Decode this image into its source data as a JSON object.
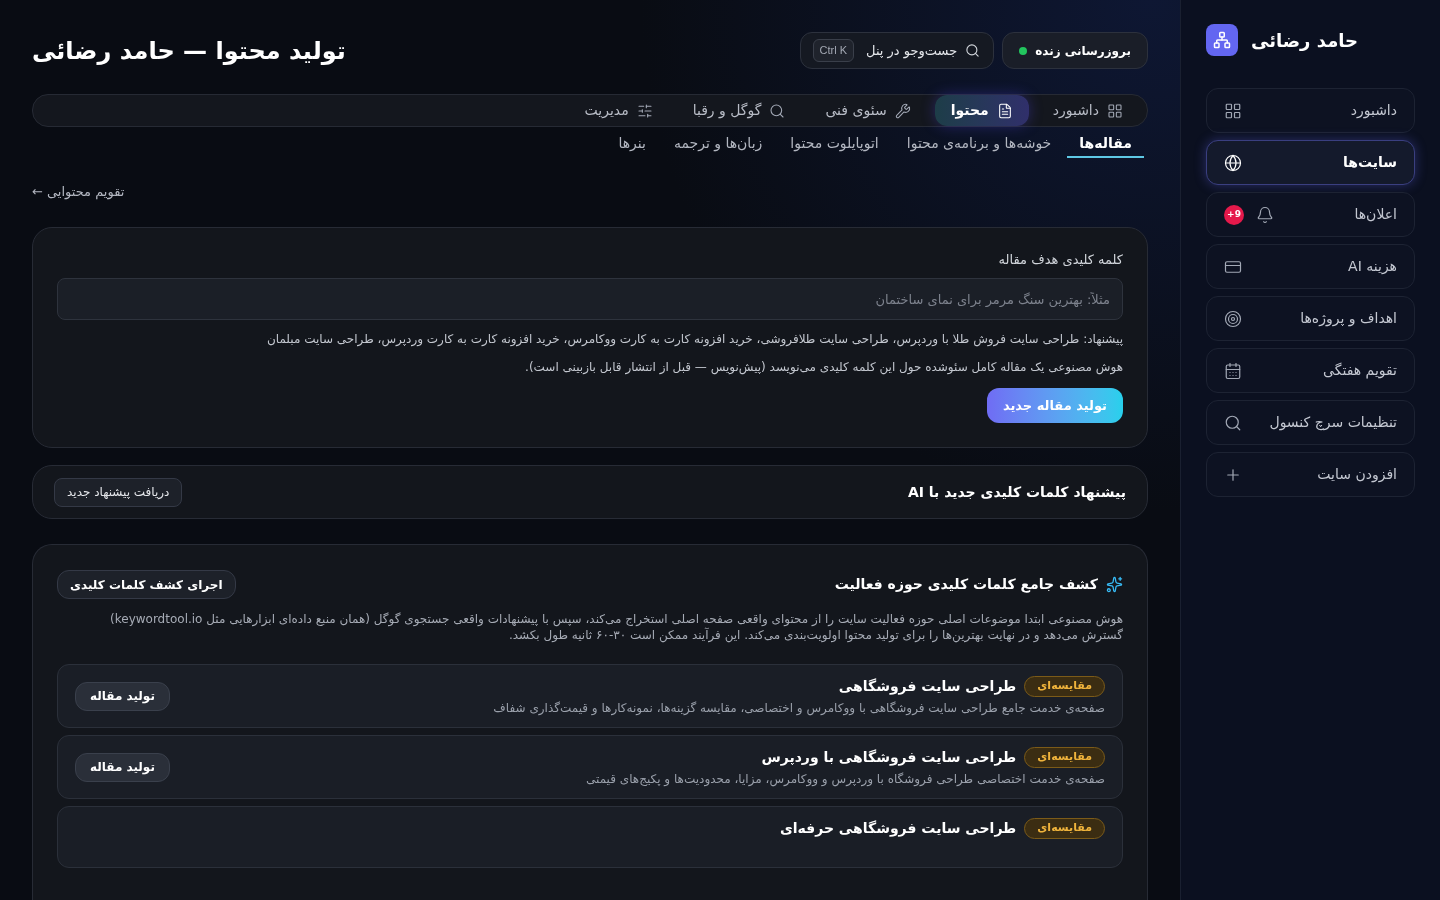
{
  "sidebar": {
    "brand": "حامد رضائی",
    "items": [
      {
        "label": "داشبورد",
        "selected": false
      },
      {
        "label": "سایت‌ها",
        "selected": true
      },
      {
        "label": "اعلان‌ها",
        "selected": false,
        "badge": "+9"
      },
      {
        "label": "هزینه AI",
        "selected": false
      },
      {
        "label": "اهداف و پروژه‌ها",
        "selected": false
      },
      {
        "label": "تقویم هفتگی",
        "selected": false
      },
      {
        "label": "تنظیمات سرچ کنسول",
        "selected": false
      },
      {
        "label": "افزودن سایت",
        "selected": false
      }
    ]
  },
  "header": {
    "title": "تولید محتوا — حامد رضائی",
    "live_update": {
      "label": "بروزرسانی زنده",
      "on": true
    },
    "search": {
      "label": "جست‌وجو در پنل",
      "shortcut": "Ctrl K"
    }
  },
  "nav_tabs": [
    {
      "label": "داشبورد",
      "selected": false
    },
    {
      "label": "محتوا",
      "selected": true
    },
    {
      "label": "سئوی فنی",
      "selected": false
    },
    {
      "label": "گوگل و رقبا",
      "selected": false
    },
    {
      "label": "مدیریت",
      "selected": false
    }
  ],
  "sub_tabs": [
    {
      "label": "مقاله‌ها",
      "selected": true
    },
    {
      "label": "خوشه‌ها و برنامه‌ی محتوا",
      "selected": false
    },
    {
      "label": "اتوپایلوت محتوا",
      "selected": false
    },
    {
      "label": "زبان‌ها و ترجمه",
      "selected": false
    },
    {
      "label": "بنرها",
      "selected": false
    }
  ],
  "calendar_link": "تقویم محتوایی ←",
  "article_form": {
    "label": "کلمه کلیدی هدف مقاله",
    "placeholder": "مثلاً: بهترین سنگ مرمر برای نمای ساختمان",
    "suggestion": "پیشنهاد: طراحی سایت فروش طلا با وردپرس، طراحی سایت طلافروشی، خرید افزونه کارت به کارت ووکامرس، خرید افزونه کارت به کارت وردپرس، طراحی سایت مبلمان",
    "note": "هوش مصنوعی یک مقاله کامل سئوشده حول این کلمه کلیدی می‌نویسد (پیش‌نویس — قبل از انتشار قابل بازبینی است).",
    "button": "تولید مقاله جدید"
  },
  "ai_suggestions": {
    "title": "پیشنهاد کلمات کلیدی جدید با AI",
    "button": "دریافت پیشنهاد جدید"
  },
  "keyword_discovery": {
    "title": "کشف جامع کلمات کلیدی حوزه فعالیت",
    "button": "اجرای کشف کلمات کلیدی",
    "description": "هوش مصنوعی ابتدا موضوعات اصلی حوزه فعالیت سایت را از محتوای واقعی صفحه اصلی استخراج می‌کند، سپس با پیشنهادات واقعی جستجوی گوگل (همان منبع داده‌ای ابزارهایی مثل keywordtool.io) گسترش می‌دهد و در نهایت بهترین‌ها را برای تولید محتوا اولویت‌بندی می‌کند. این فرآیند ممکن است ۳۰-۶۰ ثانیه طول بکشد.",
    "items": [
      {
        "badge": "مقایسه‌ای",
        "title": "طراحی سایت فروشگاهی",
        "description": "صفحه‌ی خدمت جامع طراحی سایت فروشگاهی با ووکامرس و اختصاصی، مقایسه گزینه‌ها، نمونه‌کارها و قیمت‌گذاری شفاف",
        "button": "تولید مقاله"
      },
      {
        "badge": "مقایسه‌ای",
        "title": "طراحی سایت فروشگاهی با وردپرس",
        "description": "صفحه‌ی خدمت اختصاصی طراحی فروشگاه با وردپرس و ووکامرس، مزایا، محدودیت‌ها و پکیج‌های قیمتی",
        "button": "تولید مقاله"
      },
      {
        "badge": "مقایسه‌ای",
        "title": "طراحی سایت فروشگاهی حرفه‌ای"
      }
    ]
  }
}
